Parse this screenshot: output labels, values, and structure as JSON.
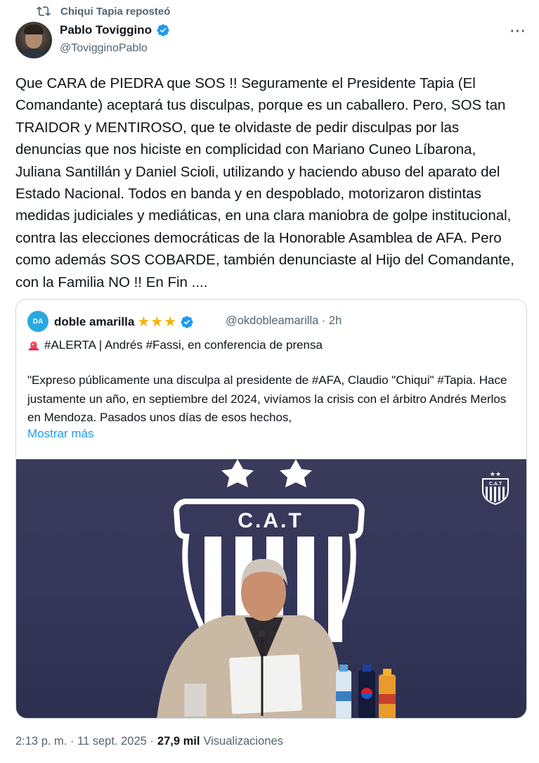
{
  "repost": {
    "icon": "repost-icon",
    "text": "Chiqui Tapia reposteó"
  },
  "author": {
    "name": "Pablo Toviggino",
    "handle": "@TovigginoPablo",
    "verified": true
  },
  "menu_icon": "more-icon",
  "post_text": "Que CARA de PIEDRA que SOS !! Seguramente el Presidente Tapia (El Comandante) aceptará tus disculpas, porque es un caballero. Pero, SOS tan TRAIDOR y MENTIROSO, que te olvidaste de pedir disculpas por las denuncias que nos hiciste en complicidad con Mariano Cuneo Líbarona, Juliana Santillán y Daniel Scioli, utilizando y haciendo abuso del aparato del Estado Nacional. Todos en banda y en despoblado, motorizaron distintas medidas judiciales y mediáticas, en una clara maniobra de golpe institucional, contra las elecciones democráticas de la Honorable Asamblea de AFA. Pero como además SOS COBARDE, también denunciaste al Hijo del Comandante, con la Familia NO !! En Fin ....",
  "quote": {
    "avatar_text": "DA",
    "name": "doble amarilla",
    "stars": "★★★",
    "handle": "@okdobleamarilla",
    "time": "· 2h",
    "alert": "#ALERTA | Andrés #Fassi, en conferencia de prensa",
    "body": "\"Expreso públicamente una disculpa al presidente de #AFA, Claudio \"Chiqui\" #Tapia. Hace justamente un año, en septiembre del 2024, vivíamos la crisis con el árbitro Andrés Merlos en Mendoza. Pasados unos días de esos hechos,",
    "show_more": "Mostrar más",
    "media": {
      "crest_text": "C.A.T",
      "small_crest_text": "C.A.T"
    }
  },
  "footer": {
    "time": "2:13 p. m. · 11 sept. 2025 ·",
    "views_count": "27,9 mil",
    "views_label": "Visualizaciones"
  },
  "colors": {
    "accent": "#1d9bf0",
    "muted": "#536471",
    "border": "#cfd9de"
  }
}
